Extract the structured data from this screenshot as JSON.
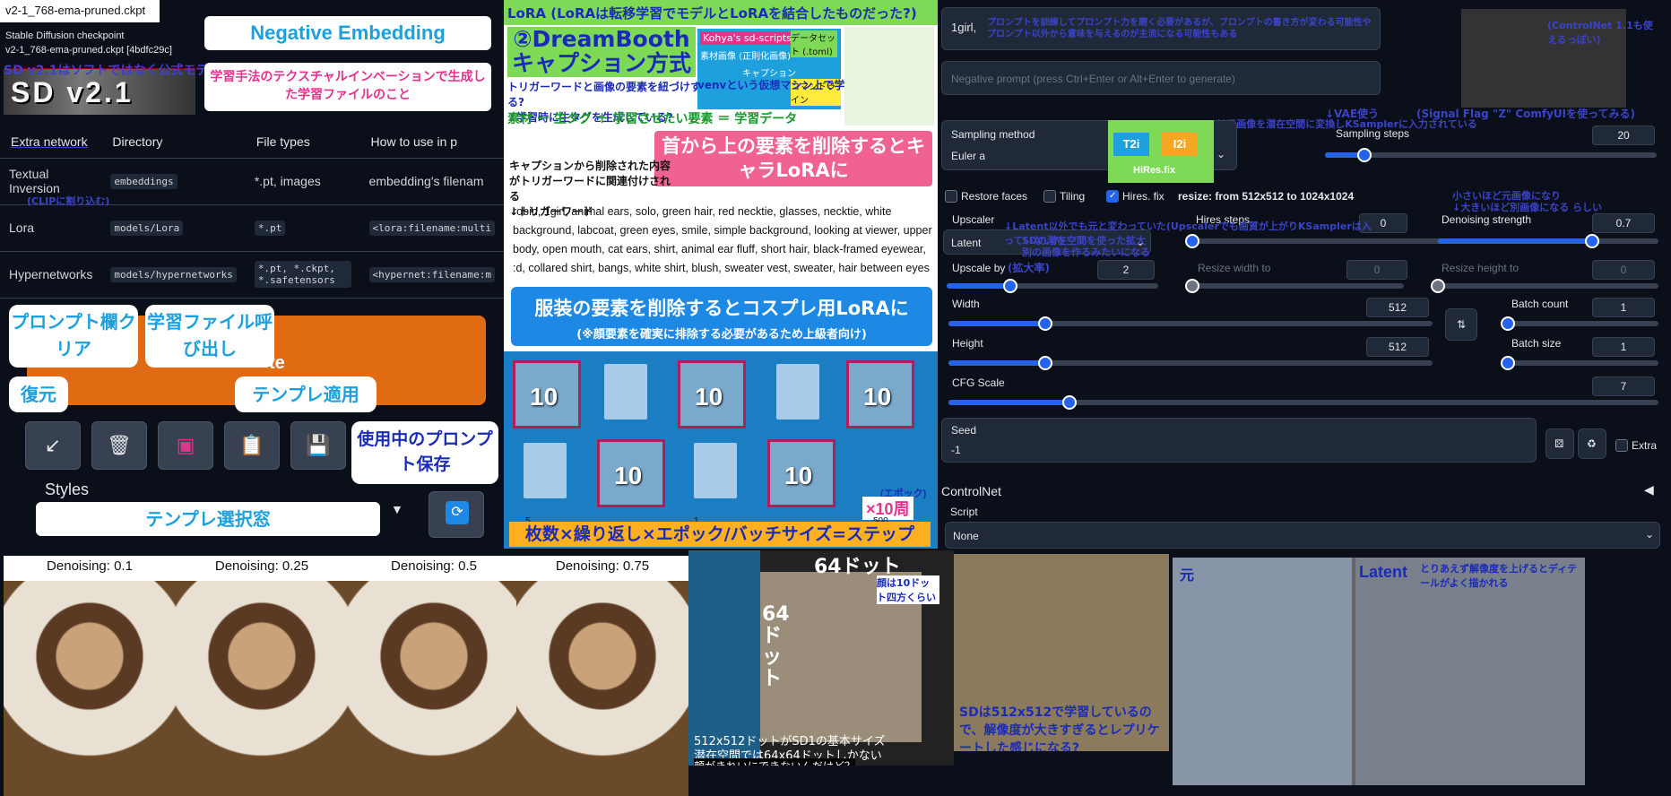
{
  "checkpoint": {
    "tab": "v2-1_768-ema-pruned.ckpt",
    "label": "Stable Diffusion checkpoint",
    "value": "v2-1_768-ema-pruned.ckpt [4bdfc29c]",
    "banner": "SD v2.1",
    "note": "SD v2.1はソフトではなく公式モデル？"
  },
  "neg_embed": {
    "title": "Negative Embedding",
    "sub": "学習手法のテクスチャルインベーションで生成した学習ファイルのこと"
  },
  "extra_table": {
    "headers": [
      "Extra network",
      "Directory",
      "File types",
      "How to use in p"
    ],
    "rows": [
      {
        "name": "Textual Inversion",
        "dir": "embeddings",
        "types": "*.pt, images",
        "use": "embedding's filenam"
      },
      {
        "name": "Lora",
        "dir": "models/Lora",
        "types": "*.pt",
        "use": "<lora:filename:multi"
      },
      {
        "name": "Hypernetworks",
        "dir": "models/hypernetworks",
        "types": "*.pt, *.ckpt, *.safetensors",
        "use": "<hypernet:filename:m"
      }
    ],
    "clip_note": "(CLIPに割り込む)"
  },
  "toolbar": {
    "generate_suffix": "te",
    "bubble_clear": "プロンプト欄クリア",
    "bubble_load": "学習ファイル呼び出し",
    "bubble_restore": "復元",
    "bubble_apply": "テンプレ適用",
    "bubble_save": "使用中のプロンプト保存",
    "styles_label": "Styles",
    "styles_box": "テンプレ選択窓"
  },
  "lora": {
    "header": "LoRA (LoRAは転移学習でモデルとLoRAを結合したものだった?)",
    "title": "②DreamBoothキャプション方式",
    "trigger_note": "トリガーワードと画像の要素を紐づけする?\n↓学習時に生タグを生成している?",
    "equation": "素材 ー 生タグ ＋ 学習させたい要素 ＝ 学習データ",
    "kohya": "Kohya's sd-scripts",
    "data_set": "データセット (.toml)",
    "material": "素材画像 (正則化画像)",
    "caption": "キャプション",
    "cmdline": "コマンドライン",
    "venv": "venvという仮想マシン上で学習",
    "pink_box": "首から上の要素を削除するとキャラLoRAに",
    "cap_note": "キャプションから削除された内容がトリガーワードに関連付けされる\n↓トリガーワード",
    "tags": "robin, 1girl, animal ears, solo, green hair, red necktie, glasses, necktie, white background, labcoat, green eyes, smile, simple background, looking at viewer, upper body, open mouth, cat ears, shirt, animal ear fluff, short hair, black-framed eyewear, :d, collared shirt, bangs, white shirt, blush, sweater vest, sweater, hair between eyes",
    "blue_bar_1": "服装の要素を削除するとコスプレ用LoRAに",
    "blue_bar_2": "(※顔要素を確実に排除する必要があるため上級者向け)"
  },
  "grid": {
    "num": "10",
    "epoch": "(エポック)",
    "times": "×10周",
    "bar": "枚数×繰り返し×エポック/バッチサイズ=ステップ",
    "n5": "5",
    "n1": "1",
    "n500": "500"
  },
  "right": {
    "prompt": "1girl,",
    "prompt_note": "プロンプトを訓練してプロンプト力を磨く必要があるが、プロンプトの書き方が変わる可能性やプロンプト以外から意味を与えるのが主流になる可能性もある",
    "controlnet_note": "(ControlNet 1.1も使えるっぽい)",
    "neg_placeholder": "Negative prompt (press Ctrl+Enter or Alt+Enter to generate)",
    "sampling_method": "Sampling method",
    "sampler": "Euler a",
    "sampling_steps": "Sampling steps",
    "steps": "20",
    "vae_note": "↓VAE使う",
    "signal_note": "(Signal Flag \"Z\" ComfyUIを使ってみる)",
    "i2i_note": "i2iは元画像を潜在空間に変換しKSamplerに入力されている",
    "t2i": "T2i",
    "i2i": "I2i",
    "hires_badge": "HiRes.fix",
    "restore_faces": "Restore faces",
    "tiling": "Tiling",
    "hires_fix": "Hires. fix",
    "resize_info": "resize: from 512x512 to 1024x1024",
    "small_note": "小さいほど元画像になり\n↓大きいほど別画像になる らしい",
    "upscaler": "Upscaler",
    "upscaler_val": "Latent",
    "hires_steps": "Hires steps",
    "denoise": "Denoising strength",
    "denoise_val": "0.7",
    "latent_note": "↓Latent以外でも元と変わっていた(Upscalerでも画質が上がりKSamplerは入っていない?)",
    "sd_note": "SDの潜在空間を使った拡大\n別の画像を作るみたいになる",
    "zoom_note": "(拡大率)",
    "upscale_by": "Upscale by",
    "upscale_val": "2",
    "hires_steps_val": "0",
    "resize_w": "Resize width to",
    "resize_w_val": "0",
    "resize_h": "Resize height to",
    "resize_h_val": "0",
    "width": "Width",
    "width_val": "512",
    "height": "Height",
    "height_val": "512",
    "batch_count": "Batch count",
    "batch_count_val": "1",
    "batch_size": "Batch size",
    "batch_size_val": "1",
    "cfg": "CFG Scale",
    "cfg_val": "7",
    "seed": "Seed",
    "seed_val": "-1",
    "extra": "Extra",
    "controlnet": "ControlNet",
    "script": "Script",
    "script_val": "None"
  },
  "denoise_samples": [
    "Denoising: 0.1",
    "Denoising: 0.25",
    "Denoising: 0.5",
    "Denoising: 0.75"
  ],
  "dots": {
    "top": "64ドット",
    "side": "64ドット",
    "face": "顔は10ドット四方くらい",
    "caption1": "512x512ドットがSD1の基本サイズ",
    "caption2": "潜在空間では64x64ドットしかない",
    "caption3": "顔がきれいにできないんだけど？"
  },
  "sd_group_note": "SDは512x512で学習しているので、解像度が大きすぎるとレプリケートした感じになる?",
  "compare": {
    "left": "元",
    "right": "Latent",
    "right_note": "とりあえず解像度を上げるとディテールがよく描かれる"
  }
}
